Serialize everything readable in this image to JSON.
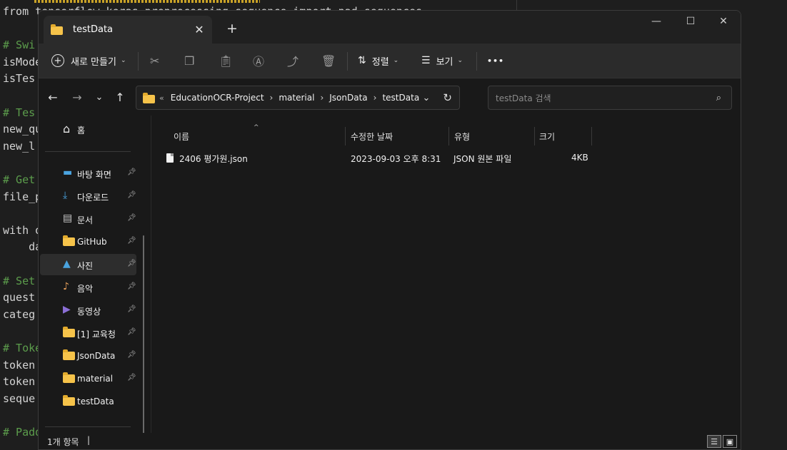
{
  "editor": {
    "lines": [
      {
        "text": "from tensorflow.keras.preprocessing.sequence import pad_sequences",
        "type": "code"
      },
      {
        "text": "",
        "type": "code"
      },
      {
        "text": "# Swi",
        "type": "comment"
      },
      {
        "text": "isMode",
        "type": "code"
      },
      {
        "text": "isTes",
        "type": "code"
      },
      {
        "text": "",
        "type": "code"
      },
      {
        "text": "# Tes",
        "type": "comment"
      },
      {
        "text": "new_qu",
        "type": "code"
      },
      {
        "text": "new_l",
        "type": "code"
      },
      {
        "text": "",
        "type": "code"
      },
      {
        "text": "# Get",
        "type": "comment"
      },
      {
        "text": "file_p",
        "type": "code"
      },
      {
        "text": "",
        "type": "code"
      },
      {
        "text": "with o",
        "type": "code"
      },
      {
        "text": "    da",
        "type": "code"
      },
      {
        "text": "",
        "type": "code"
      },
      {
        "text": "# Set",
        "type": "comment"
      },
      {
        "text": "quest",
        "type": "code"
      },
      {
        "text": "categ",
        "type": "code"
      },
      {
        "text": "",
        "type": "code"
      },
      {
        "text": "# Toke",
        "type": "comment"
      },
      {
        "text": "token",
        "type": "code"
      },
      {
        "text": "token",
        "type": "code"
      },
      {
        "text": "seque",
        "type": "code"
      },
      {
        "text": "",
        "type": "code"
      },
      {
        "text": "# Padd",
        "type": "comment"
      }
    ]
  },
  "window": {
    "tab_title": "testData",
    "tab_close": "✕",
    "new_tab": "+",
    "controls": {
      "minimize": "—",
      "maximize": "☐",
      "close": "✕"
    }
  },
  "toolbar": {
    "new_label": "새로 만들기",
    "sort_label": "정렬",
    "view_label": "보기",
    "more": "•••"
  },
  "nav": {
    "breadcrumb": [
      "EducationOCR-Project",
      "material",
      "JsonData",
      "testData"
    ],
    "search_placeholder": "testData 검색"
  },
  "sidebar": {
    "home": "홈",
    "items": [
      {
        "label": "바탕 화면",
        "icon": "desktop-icon",
        "pinned": true
      },
      {
        "label": "다운로드",
        "icon": "download-icon",
        "pinned": true
      },
      {
        "label": "문서",
        "icon": "document-icon",
        "pinned": true
      },
      {
        "label": "GitHub",
        "icon": "folder-icon",
        "pinned": true
      },
      {
        "label": "사진",
        "icon": "pictures-icon",
        "pinned": true
      },
      {
        "label": "음악",
        "icon": "music-icon",
        "pinned": true
      },
      {
        "label": "동영상",
        "icon": "video-icon",
        "pinned": true
      },
      {
        "label": "[1] 교육청",
        "icon": "folder-icon",
        "pinned": true
      },
      {
        "label": "JsonData",
        "icon": "folder-icon",
        "pinned": true
      },
      {
        "label": "material",
        "icon": "folder-icon",
        "pinned": true
      },
      {
        "label": "testData",
        "icon": "folder-icon",
        "pinned": false
      }
    ]
  },
  "columns": {
    "name": "이름",
    "modified": "수정한 날짜",
    "type": "유형",
    "size": "크기"
  },
  "files": [
    {
      "name": "2406 평가원.json",
      "modified": "2023-09-03 오후 8:31",
      "type": "JSON 원본 파일",
      "size": "4KB"
    }
  ],
  "status": {
    "item_count": "1개 항목"
  },
  "colors": {
    "accent": "#f6c34a",
    "background": "#191919",
    "toolbar": "#2b2b2b"
  }
}
